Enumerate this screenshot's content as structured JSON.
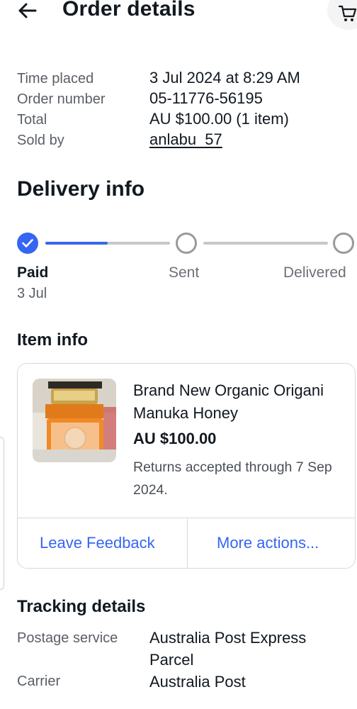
{
  "header": {
    "title": "Order details",
    "back_icon": "arrow-left-icon",
    "cart_icon": "cart-icon"
  },
  "summary": [
    {
      "label": "Time placed",
      "value": "3 Jul 2024 at 8:29 AM"
    },
    {
      "label": "Order number",
      "value": "05-11776-56195"
    },
    {
      "label": "Total",
      "value": "AU $100.00 (1 item)"
    },
    {
      "label": "Sold by",
      "value": "anlabu_57"
    }
  ],
  "delivery": {
    "heading": "Delivery info",
    "steps": [
      {
        "label": "Paid",
        "date": "3 Jul",
        "done": true
      },
      {
        "label": "Sent",
        "done": false
      },
      {
        "label": "Delivered",
        "done": false
      }
    ],
    "progress_first_segment": 0.5,
    "accent_color": "#3665f3"
  },
  "item_info": {
    "heading": "Item info",
    "title": "Brand New Organic Origani Manuka Honey",
    "price": "AU $100.00",
    "returns": "Returns accepted through 7 Sep 2024.",
    "actions": {
      "feedback": "Leave Feedback",
      "more": "More actions..."
    }
  },
  "tracking": {
    "heading": "Tracking details",
    "rows": [
      {
        "label": "Postage service",
        "value": "Australia Post Express Parcel"
      },
      {
        "label": "Carrier",
        "value": "Australia Post"
      }
    ]
  }
}
